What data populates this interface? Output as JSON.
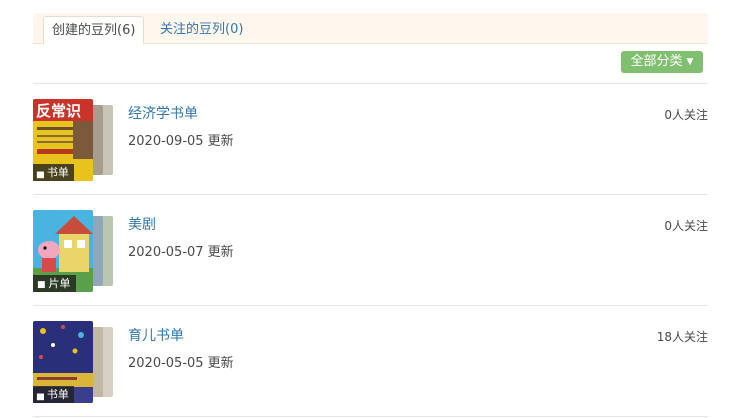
{
  "tabs": [
    {
      "label": "创建的豆列(6)",
      "active": true
    },
    {
      "label": "关注的豆列(0)",
      "active": false
    }
  ],
  "category_button": {
    "label": "全部分类",
    "icon": "caret-down-icon"
  },
  "items": [
    {
      "title": "经济学书单",
      "date": "2020-09-05 更新",
      "followers": "0人关注",
      "tag": "书单",
      "tag_icon": "book-icon",
      "cover_text": "反常识",
      "cover_colors": [
        "#e8c21d",
        "#c9342a",
        "#6b4e2a"
      ]
    },
    {
      "title": "美剧",
      "date": "2020-05-07 更新",
      "followers": "0人关注",
      "tag": "片单",
      "tag_icon": "film-icon",
      "cover_text": "",
      "cover_colors": [
        "#4bb3e0",
        "#f3a6c0",
        "#5aa04a"
      ]
    },
    {
      "title": "育儿书单",
      "date": "2020-05-05 更新",
      "followers": "18人关注",
      "tag": "书单",
      "tag_icon": "book-icon",
      "cover_text": "",
      "cover_colors": [
        "#2a2f7a",
        "#d9b63a",
        "#8a3f2d"
      ]
    }
  ]
}
